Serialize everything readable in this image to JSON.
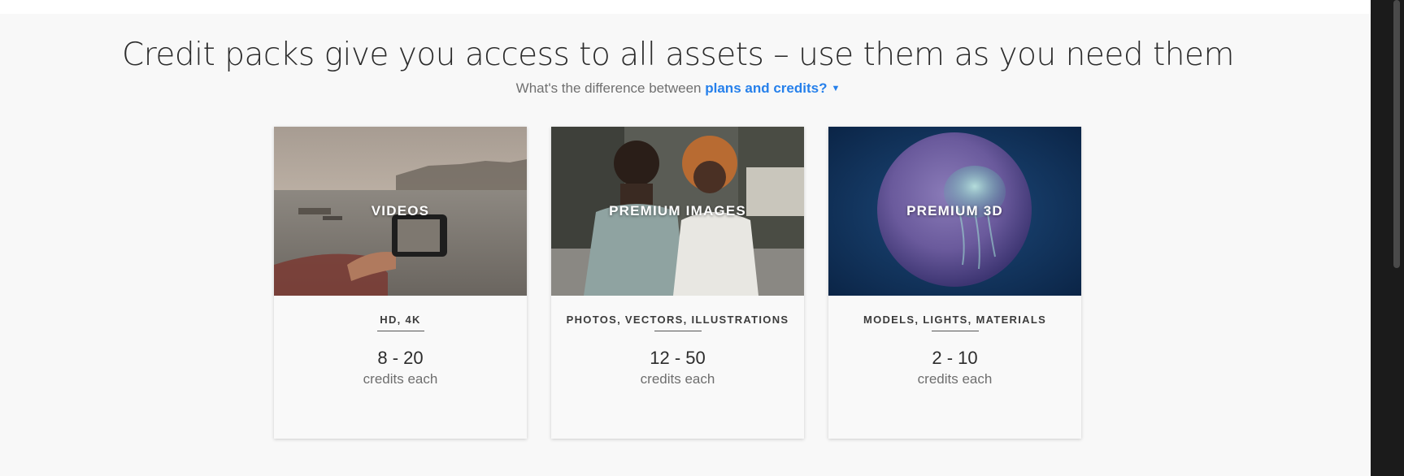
{
  "header": {
    "headline": "Credit packs give you access to all assets – use them as you need them",
    "subline_prefix": "What's the difference between",
    "subline_link": "plans and credits?"
  },
  "cards": [
    {
      "title": "VIDEOS",
      "types": "HD, 4K",
      "range": "8 - 20",
      "unit": "credits each"
    },
    {
      "title": "PREMIUM IMAGES",
      "types": "PHOTOS, VECTORS, ILLUSTRATIONS",
      "range": "12 - 50",
      "unit": "credits each"
    },
    {
      "title": "PREMIUM 3D",
      "types": "MODELS, LIGHTS, MATERIALS",
      "range": "2 - 10",
      "unit": "credits each"
    }
  ],
  "colors": {
    "link": "#2680eb",
    "page_background": "#f8f8f8"
  },
  "icons": {
    "subline_chevron": "chevron-down-icon"
  }
}
